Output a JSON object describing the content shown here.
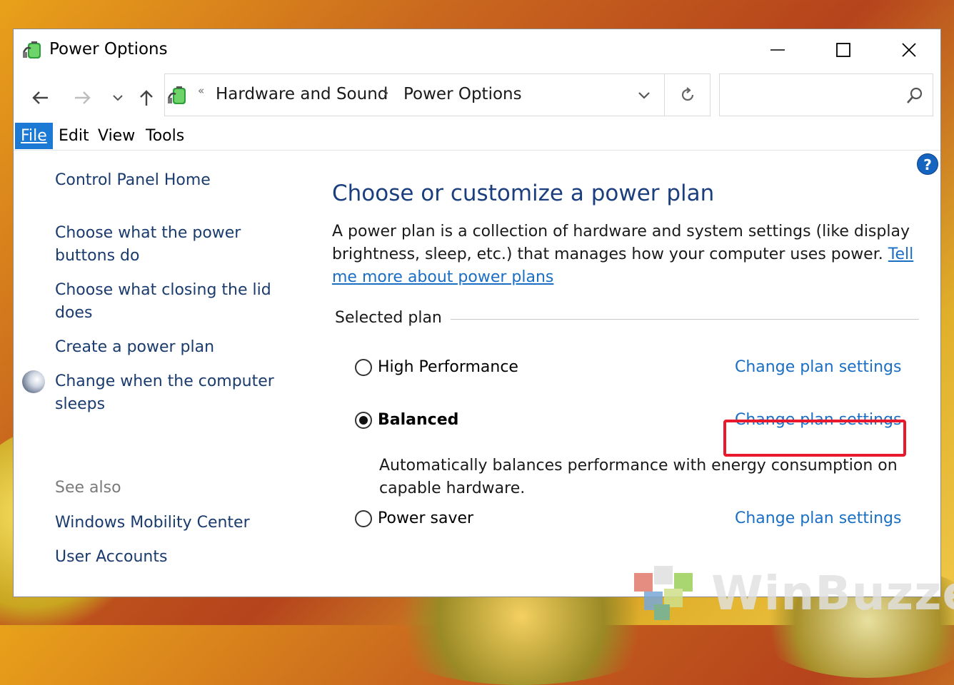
{
  "window": {
    "title": "Power Options"
  },
  "address": {
    "overflow_chevron": "«",
    "crumbs": [
      "Hardware and Sound",
      "Power Options"
    ],
    "separator": "›"
  },
  "search": {
    "placeholder": ""
  },
  "menu": {
    "file": "File",
    "edit": "Edit",
    "view": "View",
    "tools": "Tools"
  },
  "help": {
    "label": "?"
  },
  "sidebar": {
    "home": "Control Panel Home",
    "links": [
      "Choose what the power buttons do",
      "Choose what closing the lid does",
      "Create a power plan",
      "Change when the computer sleeps"
    ],
    "see_also_title": "See also",
    "see_also": [
      "Windows Mobility Center",
      "User Accounts"
    ]
  },
  "main": {
    "heading": "Choose or customize a power plan",
    "description": "A power plan is a collection of hardware and system settings (like display brightness, sleep, etc.) that manages how your computer uses power.",
    "tell_me_link": "Tell me more about power plans",
    "group_title": "Selected plan",
    "plans": [
      {
        "name": "High Performance",
        "selected": false,
        "link": "Change plan settings"
      },
      {
        "name": "Balanced",
        "selected": true,
        "link": "Change plan settings",
        "description": "Automatically balances performance with energy consumption on capable hardware."
      },
      {
        "name": "Power saver",
        "selected": false,
        "link": "Change plan settings"
      }
    ]
  },
  "watermark": {
    "text": "WinBuzzer"
  },
  "colors": {
    "link": "#1a6fc4",
    "heading": "#1b3f7e",
    "highlight": "#e8192c",
    "menu_active": "#1d7ad4"
  }
}
